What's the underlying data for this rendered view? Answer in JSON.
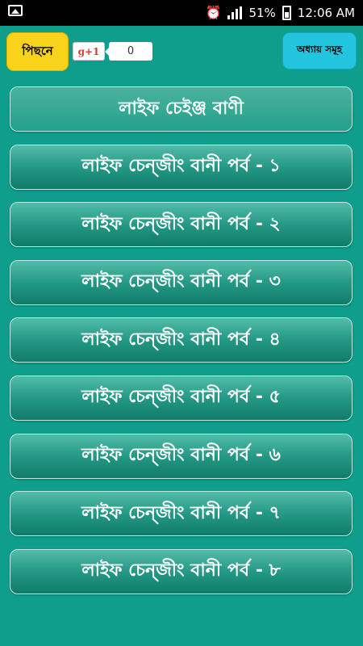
{
  "status_bar": {
    "battery_percent": "51%",
    "time": "12:06 AM"
  },
  "header": {
    "back_label": "পিছনে",
    "gplus_label": "g+1",
    "gplus_count": "0",
    "chapters_label": "অধ্যায় সমূহ"
  },
  "list": {
    "items": [
      {
        "label": "লাইফ চেইঞ্জ বাণী"
      },
      {
        "label": "লাইফ চেন্জীং বানী পর্ব - ১"
      },
      {
        "label": "লাইফ চেন্জীং বানী পর্ব - ২"
      },
      {
        "label": "লাইফ চেন্জীং বানী পর্ব - ৩"
      },
      {
        "label": "লাইফ চেন্জীং বানী পর্ব - ৪"
      },
      {
        "label": "লাইফ চেন্জীং বানী পর্ব - ৫"
      },
      {
        "label": "লাইফ চেন্জীং বানী পর্ব - ৬"
      },
      {
        "label": "লাইফ চেন্জীং বানী পর্ব - ৭"
      },
      {
        "label": "লাইফ চেন্জীং বানী পর্ব - ৮"
      }
    ]
  },
  "colors": {
    "background": "#0f9e8b",
    "back_button": "#f8d21b",
    "chapters_button": "#23c4dd",
    "list_item": "#249985"
  },
  "icons": [
    "image-notification-icon",
    "alarm-icon",
    "signal-icon",
    "battery-icon"
  ]
}
